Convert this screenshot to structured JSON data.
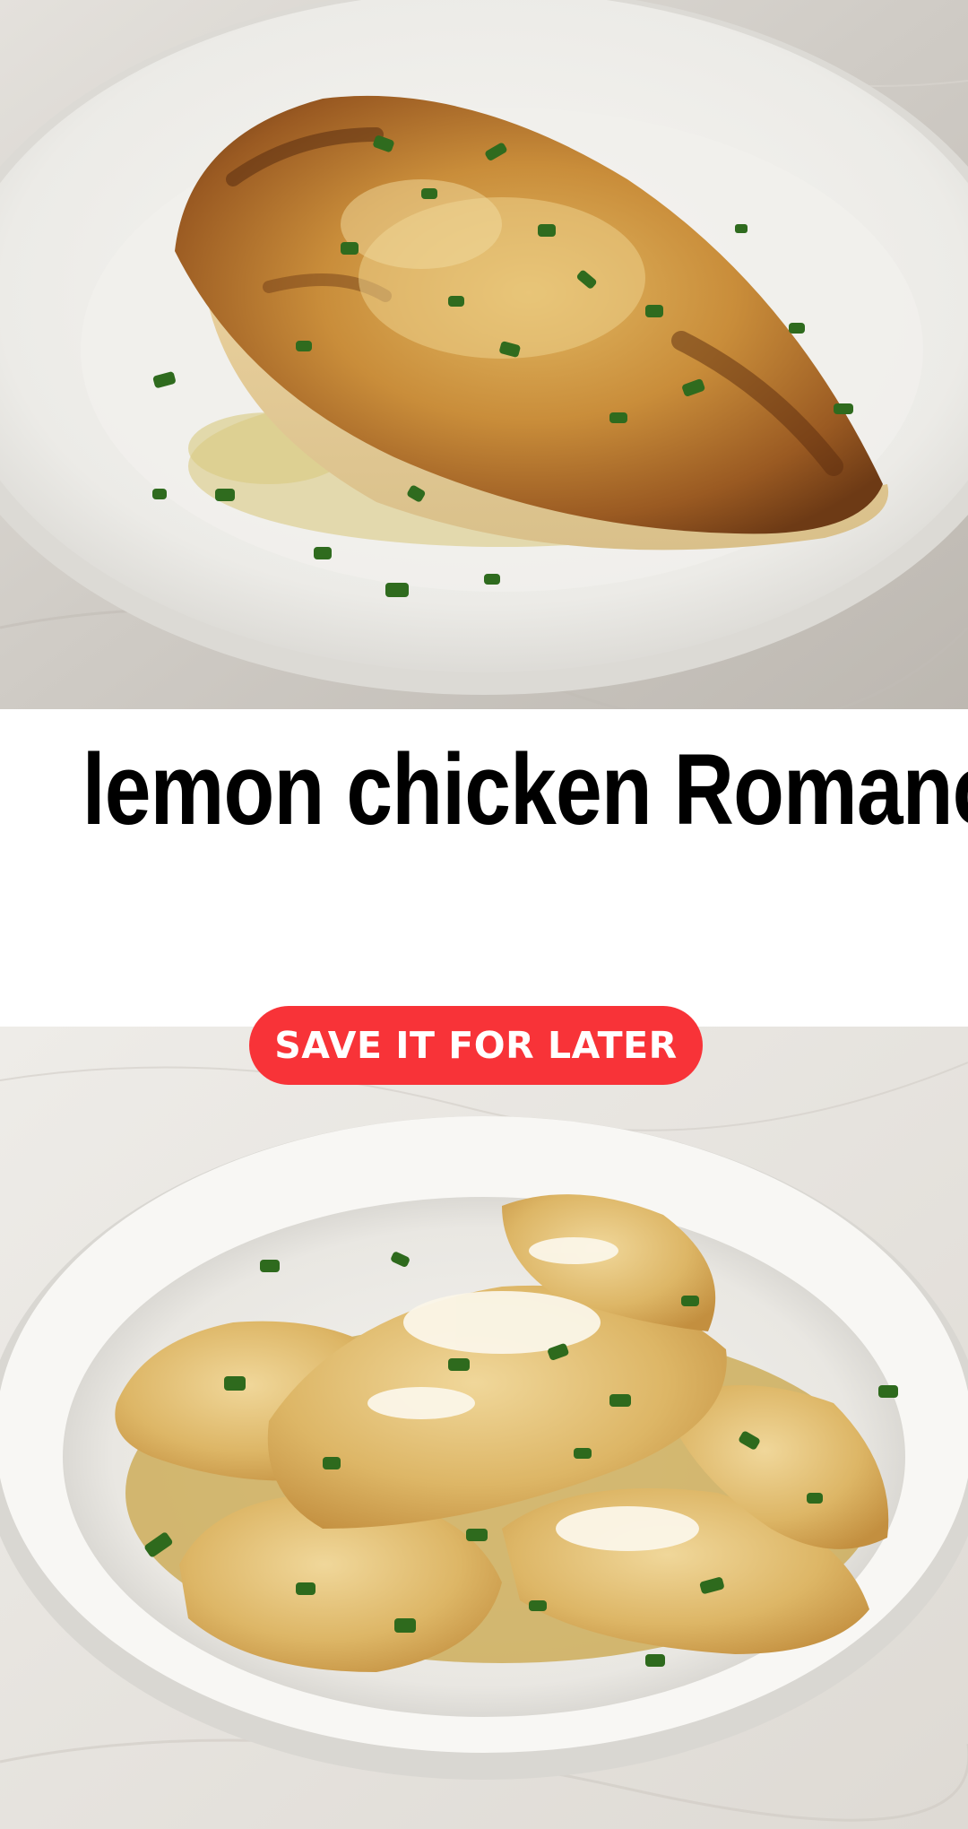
{
  "title": "lemon chicken Romano",
  "save_button": {
    "label": "SAVE IT FOR LATER"
  },
  "images": {
    "top": {
      "subject": "seared chicken breast with parsley in lemon sauce on white plate"
    },
    "bottom": {
      "subject": "chicken cutlets with grated cheese and parsley in lemon butter sauce in white bowl"
    }
  },
  "colors": {
    "button": "#f83338",
    "button_text": "#ffffff",
    "title_text": "#000000",
    "background": "#ffffff"
  }
}
